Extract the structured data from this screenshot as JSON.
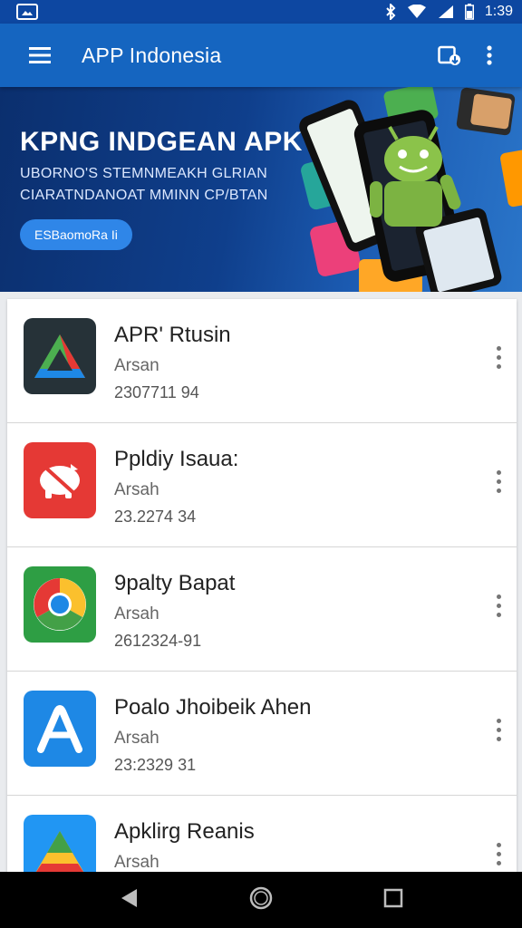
{
  "status_bar": {
    "time": "1:39"
  },
  "app_bar": {
    "title": "APP Indonesia"
  },
  "banner": {
    "title": "KPNG INDGEAN APK",
    "subtitle": "UBORNO'S STEMNMEAKH GLRIAN CIARATNDANOAT MMINN CP/BTAN",
    "button_label": "ESBaomoRa Ii"
  },
  "apps": [
    {
      "name": "APR' Rtusin",
      "category": "Arsan",
      "version": "2307711 94",
      "icon": "triangle-logo-icon",
      "color": "#263238"
    },
    {
      "name": "Ppldiy Isaua:",
      "category": "Arsah",
      "version": "23.2274 34",
      "icon": "piggy-bank-icon",
      "color": "#e53935"
    },
    {
      "name": "9palty Bapat",
      "category": "Arsah",
      "version": "2612324-91",
      "icon": "chrome-icon",
      "color": "#2e9e44"
    },
    {
      "name": "Poalo Jhoibeik Ahen",
      "category": "Arsah",
      "version": "23:2329 31",
      "icon": "letter-a-icon",
      "color": "#1e88e5"
    },
    {
      "name": "Apklirg Reanis",
      "category": "Arsah",
      "version": "",
      "icon": "drive-icon",
      "color": "#2196f3"
    }
  ],
  "colors": {
    "app_bar": "#1565c0",
    "status_bar": "#0d47a1",
    "accent": "#2f86e8"
  }
}
